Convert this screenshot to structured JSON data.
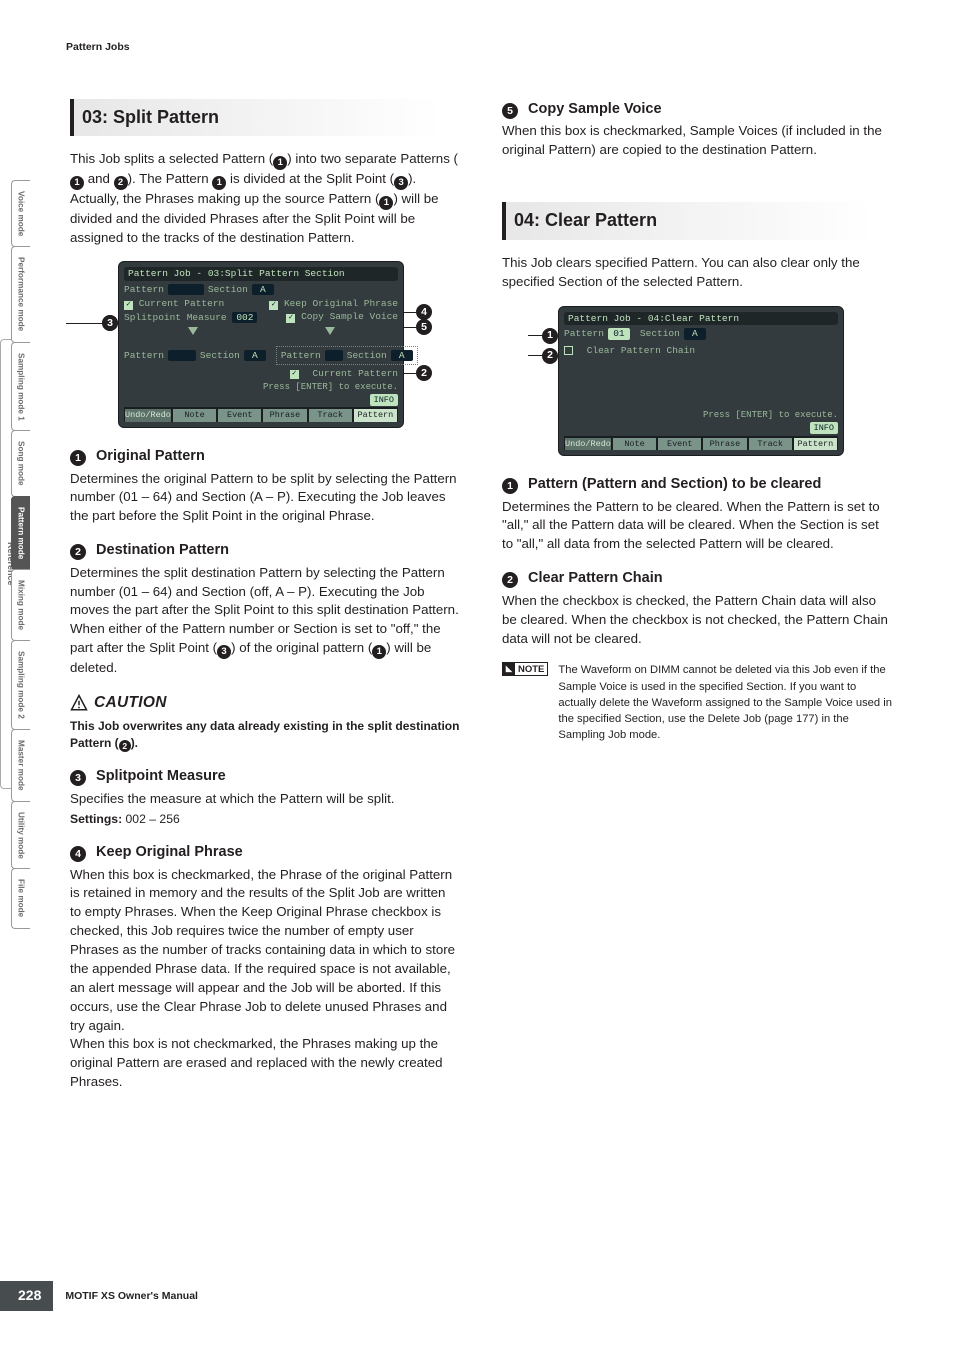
{
  "crumb": "Pattern Jobs",
  "split": {
    "title": "03: Split Pattern",
    "intro_parts": [
      "This Job splits a selected Pattern (",
      ") into two separate Patterns (",
      " and ",
      "). The Pattern ",
      " is divided at the Split Point (",
      "). Actually, the Phrases making up the source Pattern (",
      ") will be divided and the divided Phrases after the Split Point will be assigned to the tracks of the destination Pattern."
    ],
    "fig": {
      "title": "Pattern Job - 03:Split Pattern Section",
      "pattern_lbl": "Pattern",
      "section_lbl": "Section",
      "section_val": "A",
      "cur_pattern": "Current Pattern",
      "splitpoint_lbl": "Splitpoint Measure",
      "splitpoint_val": "002",
      "keep_lbl": "Keep Original Phrase",
      "copy_lbl": "Copy Sample Voice",
      "dest_pattern_lbl": "Pattern",
      "dest_section_lbl": "Section",
      "dest_section_val": "A",
      "dest2_pattern_lbl": "Pattern",
      "dest2_section_lbl": "Section",
      "dest2_section_val": "A",
      "dest2_cur": "Current Pattern",
      "press": "Press [ENTER] to execute.",
      "info": "INFO",
      "tabs": [
        "Undo/Redo",
        "Note",
        "Event",
        "Phrase",
        "Track",
        "Pattern"
      ]
    },
    "h1": {
      "num": "1",
      "title": "Original Pattern",
      "body": "Determines the original Pattern to be split by selecting the Pattern number (01 – 64) and Section (A – P). Executing the Job leaves the part before the Split Point in the original Phrase."
    },
    "h2": {
      "num": "2",
      "title": "Destination Pattern",
      "body_parts": [
        "Determines the split destination Pattern by selecting the Pattern number (01 – 64) and Section (off, A – P). Executing the Job moves the part after the Split Point to this split destination Pattern. When either of the Pattern number or Section is set to \"off,\" the part after the Split Point (",
        ") of the original pattern (",
        ") will be deleted."
      ]
    },
    "caution": {
      "word": "CAUTION",
      "text_parts": [
        "This Job overwrites any data already existing in the split destination Pattern (",
        ")."
      ]
    },
    "h3": {
      "num": "3",
      "title": "Splitpoint Measure",
      "body": "Specifies the measure at which the Pattern will be split.",
      "settings_lbl": "Settings:",
      "settings_val": "002 – 256"
    },
    "h4": {
      "num": "4",
      "title": "Keep Original Phrase",
      "body1": "When this box is checkmarked, the Phrase of the original Pattern is retained in memory and the results of the Split Job are written to empty Phrases. When the Keep Original Phrase checkbox is checked, this Job requires twice the number of empty user Phrases as the number of tracks containing data in which to store the appended Phrase data. If the required space is not available, an alert message will appear and the Job will be aborted. If this occurs, use the Clear Phrase Job to delete unused Phrases and try again.",
      "body2": "When this box is not checkmarked, the Phrases making up the original Pattern are erased and replaced with the newly created Phrases."
    },
    "h5": {
      "num": "5",
      "title": "Copy Sample Voice",
      "body": "When this box is checkmarked, Sample Voices (if included in the original Pattern) are copied to the destination Pattern."
    }
  },
  "clear": {
    "title": "04: Clear Pattern",
    "intro": "This Job clears specified Pattern. You can also clear only the specified Section of the selected Pattern.",
    "fig": {
      "title": "Pattern Job - 04:Clear Pattern",
      "pattern_lbl": "Pattern",
      "pattern_val": "01",
      "section_lbl": "Section",
      "section_val": "A",
      "chain_lbl": "Clear Pattern Chain",
      "press": "Press [ENTER] to execute.",
      "info": "INFO",
      "tabs": [
        "Undo/Redo",
        "Note",
        "Event",
        "Phrase",
        "Track",
        "Pattern"
      ]
    },
    "h1": {
      "num": "1",
      "title": "Pattern (Pattern and Section) to be cleared",
      "body": "Determines the Pattern to be cleared. When the Pattern is set to \"all,\" all the Pattern data will be cleared. When the Section is set to \"all,\" all data from the selected Pattern will be cleared."
    },
    "h2": {
      "num": "2",
      "title": "Clear Pattern Chain",
      "body": "When the checkbox is checked, the Pattern Chain data will also be cleared. When the checkbox is not checked, the Pattern Chain data will not be cleared."
    },
    "note": {
      "label": "NOTE",
      "text": "The Waveform on DIMM cannot be deleted via this Job even if the Sample Voice is used in the specified Section. If you want to actually delete the Waveform assigned to the Sample Voice used in the specified Section, use the Delete Job (page 177) in the Sampling Job mode."
    }
  },
  "side_tabs": [
    "Voice mode",
    "Performance mode",
    "Sampling mode 1",
    "Song mode",
    "Pattern mode",
    "Mixing mode",
    "Sampling mode 2",
    "Master mode",
    "Utility mode",
    "File mode"
  ],
  "side_ref": "Reference",
  "footer": {
    "page": "228",
    "manual": "MOTIF XS Owner's Manual"
  }
}
